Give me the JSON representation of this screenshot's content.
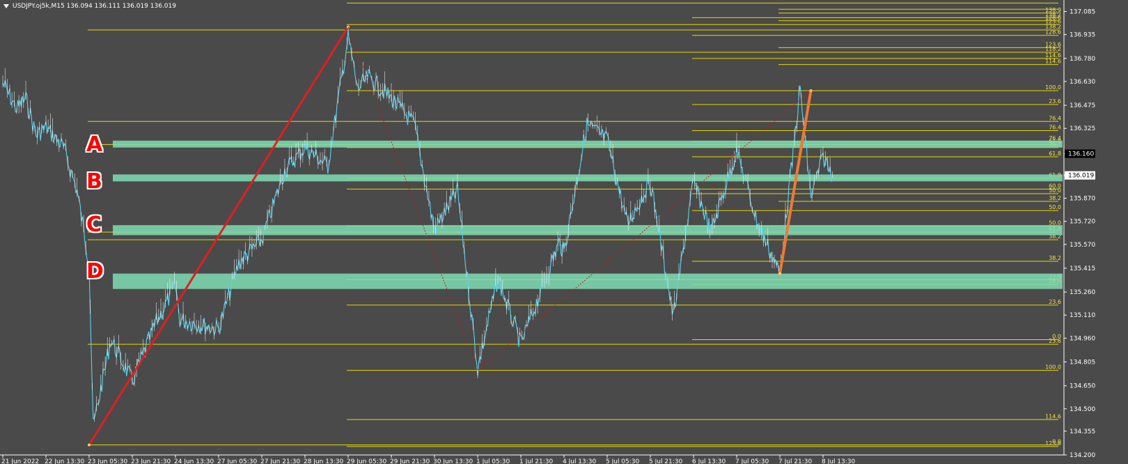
{
  "header": {
    "symbol_info": "USDJPY.oj5k,M15  136.094 136.111 136.019 136.019"
  },
  "zone_letters": [
    "A",
    "B",
    "C",
    "D"
  ],
  "colors": {
    "background": "#4a4a4a",
    "price_line": "#5ad4f0",
    "grid_line": "#e6d800",
    "zone_fill": "#7fdcb4",
    "trend_red": "#e01f1f",
    "trend_orange": "#ee7a33",
    "axis_text": "#ffffff",
    "level_text": "#f2e24a"
  },
  "chart_data": {
    "type": "line",
    "series": [
      {
        "values_x": [
          "21 Jun 2022",
          "21 Jun 12:00",
          "21 Jun 20:00",
          "22 Jun 05:00",
          "22 Jun 13:30",
          "22 Jun 20:00",
          "23 Jun 01:00",
          "23 Jun 05:30",
          "23 Jun 07:00",
          "23 Jun 13:30",
          "23 Jun 21:30",
          "24 Jun 06:00",
          "24 Jun 13:30",
          "24 Jun 20:00",
          "27 Jun 05:30",
          "27 Jun 13:00",
          "27 Jun 21:30",
          "28 Jun 06:00",
          "28 Jun 13:30",
          "28 Jun 22:00",
          "29 Jun 05:30",
          "29 Jun 09:00",
          "29 Jun 13:00",
          "29 Jun 21:30",
          "30 Jun 06:00",
          "30 Jun 13:30",
          "30 Jun 22:00",
          "1 Jul 05:30",
          "1 Jul 13:00",
          "1 Jul 21:30",
          "4 Jul 06:00",
          "4 Jul 13:30",
          "4 Jul 22:00",
          "5 Jul 05:30",
          "5 Jul 13:00",
          "5 Jul 21:30",
          "6 Jul 06:00",
          "6 Jul 13:30",
          "6 Jul 20:00",
          "7 Jul 05:30",
          "7 Jul 13:00",
          "7 Jul 21:30",
          "8 Jul 05:00",
          "8 Jul 09:00",
          "8 Jul 13:30",
          "8 Jul 17:00"
        ],
        "values": [
          136.62,
          136.45,
          136.52,
          136.28,
          136.33,
          136.2,
          135.92,
          135.45,
          134.38,
          134.95,
          134.68,
          135.05,
          135.3,
          135.08,
          135.02,
          135.45,
          135.6,
          136.05,
          136.2,
          136.08,
          136.92,
          136.58,
          136.66,
          136.52,
          136.35,
          135.66,
          135.92,
          134.76,
          135.35,
          134.92,
          135.58,
          135.52,
          136.35,
          136.25,
          135.7,
          135.98,
          135.1,
          135.98,
          135.65,
          136.18,
          135.72,
          135.38,
          136.58,
          135.88,
          136.14,
          136.02
        ]
      }
    ],
    "ylim": [
      134.2,
      137.16
    ],
    "y_ticks": [
      "137.085",
      "136.935",
      "136.780",
      "136.630",
      "136.475",
      "136.325",
      "136.160",
      "136.019",
      "135.870",
      "135.720",
      "135.570",
      "135.415",
      "135.260",
      "135.110",
      "134.960",
      "134.805",
      "134.650",
      "134.500",
      "134.355",
      "134.200"
    ],
    "x_ticks": [
      "21 Jun 2022",
      "22 Jun 13:30",
      "23 Jun 05:30",
      "23 Jun 21:30",
      "24 Jun 13:30",
      "27 Jun 05:30",
      "27 Jun 21:30",
      "28 Jun 13:30",
      "29 Jun 05:30",
      "29 Jun 21:30",
      "30 Jun 13:30",
      "1 Jul 05:30",
      "1 Jul 21:30",
      "4 Jul 13:30",
      "5 Jul 05:30",
      "5 Jul 21:30",
      "6 Jul 13:30",
      "7 Jul 05:30",
      "7 Jul 21:30",
      "8 Jul 13:30"
    ],
    "current_price": "136.019",
    "box_price": "136.160",
    "zones": [
      {
        "letter": "A",
        "y_from": 136.2,
        "y_to": 136.245
      },
      {
        "letter": "B",
        "y_from": 135.98,
        "y_to": 136.025
      },
      {
        "letter": "C",
        "y_from": 135.63,
        "y_to": 135.695
      },
      {
        "letter": "D",
        "y_from": 135.28,
        "y_to": 135.38
      }
    ],
    "fib_levels": [
      {
        "y": 137.14,
        "label": "",
        "x0": "29 Jun 05:30"
      },
      {
        "y": 137.1,
        "label": "",
        "x0": "7 Jul 21:30"
      },
      {
        "y": 137.075,
        "label": "138.9",
        "x0": "7 Jul 21:30"
      },
      {
        "y": 137.045,
        "label": "138.2",
        "x0": "6 Jul 13:30"
      },
      {
        "y": 137.025,
        "label": "128.6",
        "x0": "7 Jul 21:30"
      },
      {
        "y": 137.0,
        "label": "123.6",
        "x0": "29 Jun 05:30"
      },
      {
        "y": 136.965,
        "label": "138.2",
        "x0": "23 Jun 05:30"
      },
      {
        "y": 136.93,
        "label": "128.6",
        "x0": "6 Jul 13:30"
      },
      {
        "y": 136.85,
        "label": "123.6",
        "x0": "7 Jul 21:30"
      },
      {
        "y": 136.82,
        "label": "118.2",
        "x0": "29 Jun 05:30"
      },
      {
        "y": 136.78,
        "label": "114.6",
        "x0": "6 Jul 13:30"
      },
      {
        "y": 136.74,
        "label": "114.6",
        "x0": "7 Jul 21:30"
      },
      {
        "y": 136.57,
        "label": "100.0",
        "x0": "29 Jun 05:30"
      },
      {
        "y": 136.48,
        "label": "23.6",
        "x0": "6 Jul 13:30"
      },
      {
        "y": 136.37,
        "label": "76.4",
        "x0": "23 Jun 05:30"
      },
      {
        "y": 136.31,
        "label": "76.4",
        "x0": "6 Jul 13:30"
      },
      {
        "y": 136.24,
        "label": "76.4",
        "x0": "6 Jul 13:30"
      },
      {
        "y": 136.22,
        "label": "61.8",
        "x0": "23 Jun 05:30"
      },
      {
        "y": 136.2,
        "label": "38.2",
        "x0": "29 Jun 05:30"
      },
      {
        "y": 136.14,
        "label": "61.8",
        "x0": "6 Jul 13:30"
      },
      {
        "y": 136.0,
        "label": "61.8",
        "x0": "29 Jun 05:30"
      },
      {
        "y": 135.93,
        "label": "60.0",
        "x0": "29 Jun 05:30"
      },
      {
        "y": 135.9,
        "label": "50.0",
        "x0": "6 Jul 13:30"
      },
      {
        "y": 135.85,
        "label": "38.2",
        "x0": "7 Jul 21:30"
      },
      {
        "y": 135.79,
        "label": "50.0",
        "x0": "6 Jul 13:30"
      },
      {
        "y": 135.69,
        "label": "50.0",
        "x0": "29 Jun 05:30"
      },
      {
        "y": 135.65,
        "label": "61.8",
        "x0": "23 Jun 05:30"
      },
      {
        "y": 135.6,
        "label": "38.2",
        "x0": "23 Jun 05:30"
      },
      {
        "y": 135.46,
        "label": "38.2",
        "x0": "6 Jul 13:30"
      },
      {
        "y": 135.34,
        "label": "23.6",
        "x0": "29 Jun 05:30"
      },
      {
        "y": 135.31,
        "label": "28.6",
        "x0": "6 Jul 13:30"
      },
      {
        "y": 135.175,
        "label": "23.6",
        "x0": "29 Jun 05:30"
      },
      {
        "y": 134.95,
        "label": "0.0",
        "x0": "6 Jul 13:30"
      },
      {
        "y": 134.92,
        "label": "23.6",
        "x0": "23 Jun 05:30"
      },
      {
        "y": 134.75,
        "label": "100.0",
        "x0": "29 Jun 05:30"
      },
      {
        "y": 134.43,
        "label": "114.6",
        "x0": "29 Jun 05:30"
      },
      {
        "y": 134.265,
        "label": "0.0",
        "x0": "23 Jun 05:30"
      },
      {
        "y": 134.255,
        "label": "123.6",
        "x0": "29 Jun 05:30"
      }
    ],
    "trend_lines": [
      {
        "name": "",
        "from": [
          "23 Jun 05:30",
          134.265
        ],
        "to": [
          "29 Jun 05:30",
          136.985
        ],
        "color": "#e01f1f",
        "width": 3
      },
      {
        "name": "",
        "from": [
          "7 Jul 21:30",
          135.38
        ],
        "to": [
          "8 Jul 09:00",
          136.57
        ],
        "color": "#ee7a33",
        "width": 4
      },
      {
        "name": "",
        "from": [
          "29 Jun 05:30",
          136.985
        ],
        "to": [
          "1 Jul 05:30",
          134.75
        ],
        "color": "#b82020",
        "width": 1,
        "dash": true
      },
      {
        "name": "",
        "from": [
          "1 Jul 05:30",
          134.75
        ],
        "to": [
          "8 Jul 09:00",
          136.57
        ],
        "color": "#b82020",
        "width": 1,
        "dash": true
      }
    ],
    "grid": false
  }
}
